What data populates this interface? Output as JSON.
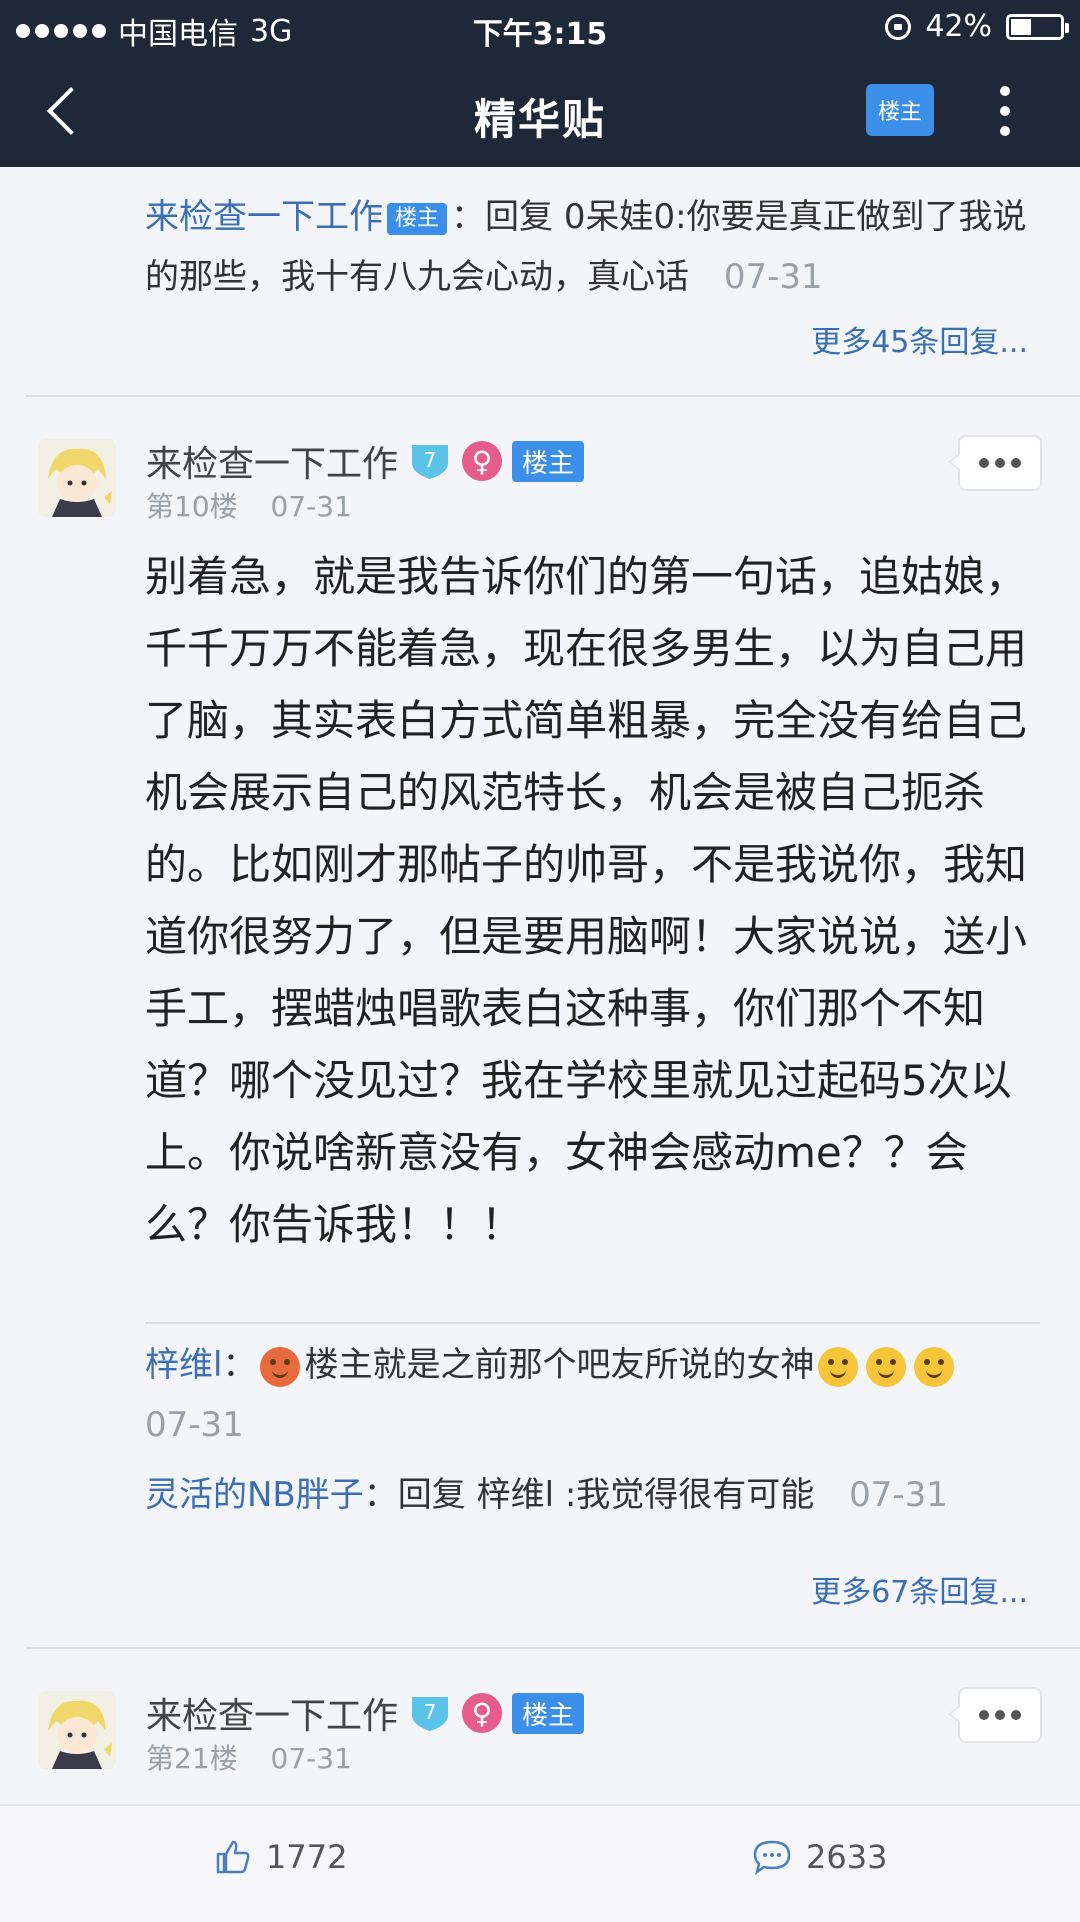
{
  "status_bar": {
    "carrier": "中国电信",
    "network": "3G",
    "time": "下午3:15",
    "battery_percent": "42%",
    "battery_level": 0.42
  },
  "nav": {
    "title": "精华贴",
    "only_op_label": "楼主",
    "back_icon": "back-arrow-icon",
    "more_icon": "vertical-dots-icon"
  },
  "reply_prev": {
    "user": "来检查一下工作",
    "tag": "楼主",
    "text": "：回复 0呆娃0:你要是真正做到了我说的那些，我十有八九会心动，真心话",
    "date": "07-31",
    "more": "更多45条回复..."
  },
  "post10": {
    "author": "来检查一下工作",
    "level": "7",
    "gender_icon": "♀",
    "op_tag": "楼主",
    "floor": "第10楼",
    "date": "07-31",
    "body": "别着急，就是我告诉你们的第一句话，追姑娘，千千万万不能着急，现在很多男生，以为自己用了脑，其实表白方式简单粗暴，完全没有给自己机会展示自己的风范特长，机会是被自己扼杀的。比如刚才那帖子的帅哥，不是我说你，我知道你很努力了，但是要用脑啊！大家说说，送小手工，摆蜡烛唱歌表白这种事，你们那个不知道？哪个没见过？我在学校里就见过起码5次以上。你说啥新意没有，女神会感动me？？会么？你告诉我！！！",
    "replies": [
      {
        "user": "梓维l",
        "sep": "：",
        "text": "楼主就是之前那个吧友所说的女神",
        "date": "07-31"
      },
      {
        "user": "灵活的NB胖子",
        "sep": "：",
        "text": "回复 梓维l :我觉得很有可能",
        "date": "07-31"
      }
    ],
    "more": "更多67条回复..."
  },
  "post21": {
    "author": "来检查一下工作",
    "level": "7",
    "gender_icon": "♀",
    "op_tag": "楼主",
    "floor": "第21楼",
    "date": "07-31"
  },
  "bottom": {
    "likes": "1772",
    "comments": "2633"
  },
  "colors": {
    "nav_bg": "#1f2838",
    "accent": "#3b8fe8",
    "username": "#3a6eb5",
    "female": "#e65c8a"
  }
}
